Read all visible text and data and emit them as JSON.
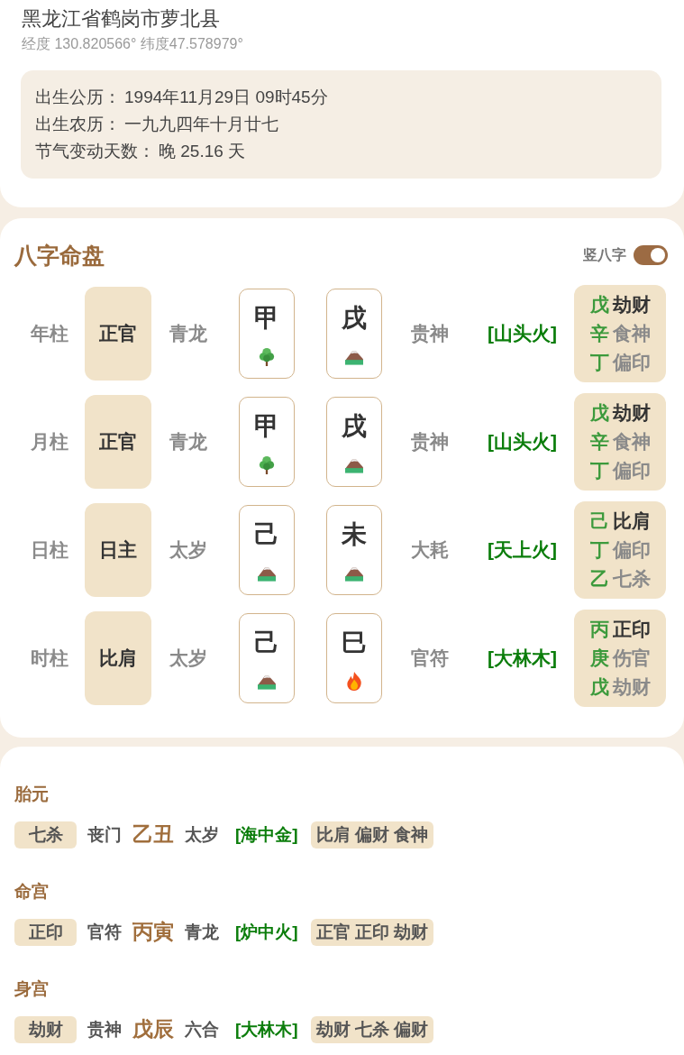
{
  "location": {
    "title": "黑龙江省鹤岗市萝北县",
    "coordinates": "经度 130.820566° 纬度47.578979°"
  },
  "birth_info": [
    {
      "label": "出生公历：",
      "value": "1994年11月29日 09时45分"
    },
    {
      "label": "出生农历：",
      "value": "一九九四年十月廿七"
    },
    {
      "label": "节气变动天数：",
      "value": "晚 25.16 天"
    }
  ],
  "chart": {
    "title": "八字命盘",
    "toggle": {
      "label": "竖八字",
      "on": true
    },
    "pillars": [
      {
        "name": "年柱",
        "ten_god": "正官",
        "star": "青龙",
        "stem": {
          "char": "甲",
          "kind": "wood"
        },
        "branch": {
          "char": "戌",
          "kind": "earth"
        },
        "shensha": "贵神",
        "nayin": "[山头火]",
        "hidden": [
          {
            "stem": "戊",
            "god": "劫财"
          },
          {
            "stem": "辛",
            "god": "食神"
          },
          {
            "stem": "丁",
            "god": "偏印"
          }
        ]
      },
      {
        "name": "月柱",
        "ten_god": "正官",
        "star": "青龙",
        "stem": {
          "char": "甲",
          "kind": "wood"
        },
        "branch": {
          "char": "戌",
          "kind": "earth"
        },
        "shensha": "贵神",
        "nayin": "[山头火]",
        "hidden": [
          {
            "stem": "戊",
            "god": "劫财"
          },
          {
            "stem": "辛",
            "god": "食神"
          },
          {
            "stem": "丁",
            "god": "偏印"
          }
        ]
      },
      {
        "name": "日柱",
        "ten_god": "日主",
        "star": "太岁",
        "stem": {
          "char": "己",
          "kind": "earth"
        },
        "branch": {
          "char": "未",
          "kind": "earth"
        },
        "shensha": "大耗",
        "nayin": "[天上火]",
        "hidden": [
          {
            "stem": "己",
            "god": "比肩"
          },
          {
            "stem": "丁",
            "god": "偏印"
          },
          {
            "stem": "乙",
            "god": "七杀"
          }
        ]
      },
      {
        "name": "时柱",
        "ten_god": "比肩",
        "star": "太岁",
        "stem": {
          "char": "己",
          "kind": "earth"
        },
        "branch": {
          "char": "巳",
          "kind": "fire"
        },
        "shensha": "官符",
        "nayin": "[大林木]",
        "hidden": [
          {
            "stem": "丙",
            "god": "正印"
          },
          {
            "stem": "庚",
            "god": "伤官"
          },
          {
            "stem": "戊",
            "god": "劫财"
          }
        ]
      }
    ]
  },
  "palaces": [
    {
      "title": "胎元",
      "ten_god": "七杀",
      "shensha": "丧门",
      "ganzhi": "乙丑",
      "star": "太岁",
      "nayin": "[海中金]",
      "hidden_gods": "比肩 偏财 食神"
    },
    {
      "title": "命宫",
      "ten_god": "正印",
      "shensha": "官符",
      "ganzhi": "丙寅",
      "star": "青龙",
      "nayin": "[炉中火]",
      "hidden_gods": "正官 正印 劫财"
    },
    {
      "title": "身宫",
      "ten_god": "劫财",
      "shensha": "贵神",
      "ganzhi": "戊辰",
      "star": "六合",
      "nayin": "[大林木]",
      "hidden_gods": "劫财 七杀 偏财"
    }
  ]
}
